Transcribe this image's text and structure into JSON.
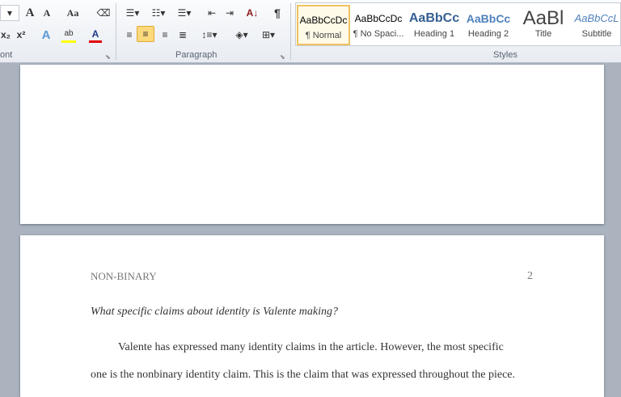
{
  "ribbon": {
    "font_group_label": "ont",
    "paragraph_group_label": "Paragraph",
    "styles_group_label": "Styles",
    "font_buttons": {
      "grow": "A",
      "shrink": "A",
      "case": "Aa",
      "subscript": "x₂",
      "superscript": "x²",
      "text_effects": "A",
      "highlight": "ab",
      "font_color": "A"
    },
    "paragraph_buttons": {
      "sort": "A↓",
      "show_marks": "¶"
    },
    "styles": [
      {
        "preview": "AaBbCcDc",
        "name": "¶ Normal"
      },
      {
        "preview": "AaBbCcDc",
        "name": "¶ No Spaci..."
      },
      {
        "preview": "AaBbCc",
        "name": "Heading 1"
      },
      {
        "preview": "AaBbCc",
        "name": "Heading 2"
      },
      {
        "preview": "AaBl",
        "name": "Title"
      },
      {
        "preview": "AaBbCcL",
        "name": "Subtitle"
      }
    ],
    "colors": {
      "highlight": "#ffff00",
      "font_color": "#e00000",
      "active": "#fcd97a"
    }
  },
  "document": {
    "header_left": "NON-BINARY",
    "page_number": "2",
    "question": "What specific claims about identity is Valente making?",
    "para_line1": "Valente has expressed many identity claims in the article. However, the most specific",
    "para_line2": "one is the nonbinary identity claim. This is the claim that was expressed throughout the piece."
  }
}
